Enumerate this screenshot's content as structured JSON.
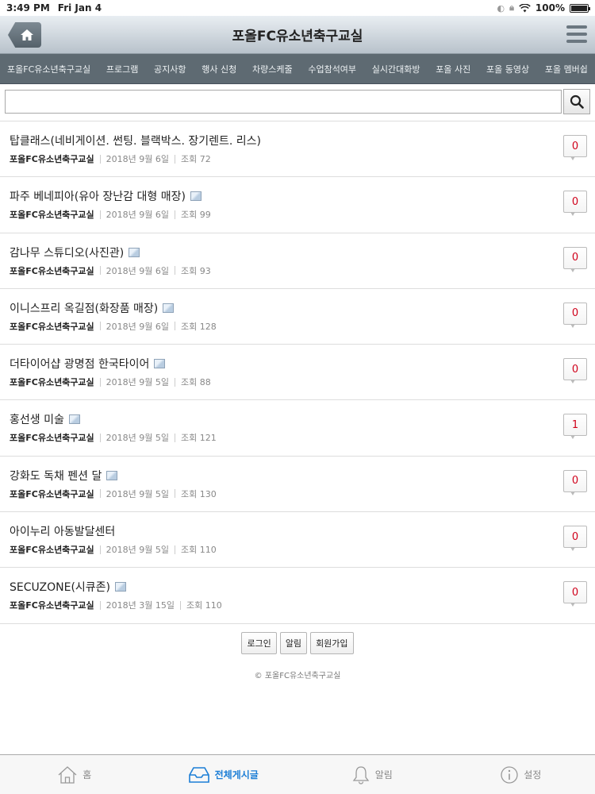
{
  "status": {
    "time": "3:49 PM",
    "date": "Fri Jan 4",
    "battery": "100%"
  },
  "header": {
    "title": "포올FC유소년축구교실"
  },
  "nav": [
    "포올FC유소년축구교실",
    "프로그램",
    "공지사항",
    "행사 신청",
    "차량스케줄",
    "수업참석여부",
    "실시간대화방",
    "포올 사진",
    "포올 동영상",
    "포올 멤버쉽"
  ],
  "search": {
    "value": "",
    "placeholder": ""
  },
  "posts": [
    {
      "title": "탑클래스(네비게이션. 썬팅. 블랙박스. 장기렌트. 리스)",
      "author": "포올FC유소년축구교실",
      "date": "2018년 9월 6일",
      "views": "조회 72",
      "comments": "0",
      "has_image": false
    },
    {
      "title": "파주 베네피아(유아 장난감 대형 매장)",
      "author": "포올FC유소년축구교실",
      "date": "2018년 9월 6일",
      "views": "조회 99",
      "comments": "0",
      "has_image": true
    },
    {
      "title": "감나무 스튜디오(사진관)",
      "author": "포올FC유소년축구교실",
      "date": "2018년 9월 6일",
      "views": "조회 93",
      "comments": "0",
      "has_image": true
    },
    {
      "title": "이니스프리 옥길점(화장품 매장)",
      "author": "포올FC유소년축구교실",
      "date": "2018년 9월 6일",
      "views": "조회 128",
      "comments": "0",
      "has_image": true
    },
    {
      "title": "더타이어샵 광명점 한국타이어",
      "author": "포올FC유소년축구교실",
      "date": "2018년 9월 5일",
      "views": "조회 88",
      "comments": "0",
      "has_image": true
    },
    {
      "title": "홍선생 미술",
      "author": "포올FC유소년축구교실",
      "date": "2018년 9월 5일",
      "views": "조회 121",
      "comments": "1",
      "has_image": true
    },
    {
      "title": "강화도 독채 펜션 달",
      "author": "포올FC유소년축구교실",
      "date": "2018년 9월 5일",
      "views": "조회 130",
      "comments": "0",
      "has_image": true
    },
    {
      "title": "아이누리 아동발달센터",
      "author": "포올FC유소년축구교실",
      "date": "2018년 9월 5일",
      "views": "조회 110",
      "comments": "0",
      "has_image": false
    },
    {
      "title": "SECUZONE(시큐존)",
      "author": "포올FC유소년축구교실",
      "date": "2018년 3월 15일",
      "views": "조회 110",
      "comments": "0",
      "has_image": true
    }
  ],
  "footer": {
    "login": "로그인",
    "alarm": "알림",
    "signup": "회원가입",
    "copyright": "© 포올FC유소년축구교실"
  },
  "tabs": [
    {
      "label": "홈",
      "icon": "home-outline-icon",
      "active": false
    },
    {
      "label": "전체게시글",
      "icon": "inbox-icon",
      "active": true
    },
    {
      "label": "알림",
      "icon": "bell-icon",
      "active": false
    },
    {
      "label": "설정",
      "icon": "info-circle-icon",
      "active": false
    }
  ],
  "colors": {
    "accent": "#1c7ed6",
    "comment_count": "#d0021b",
    "nav_bg": "#5e6a72"
  }
}
